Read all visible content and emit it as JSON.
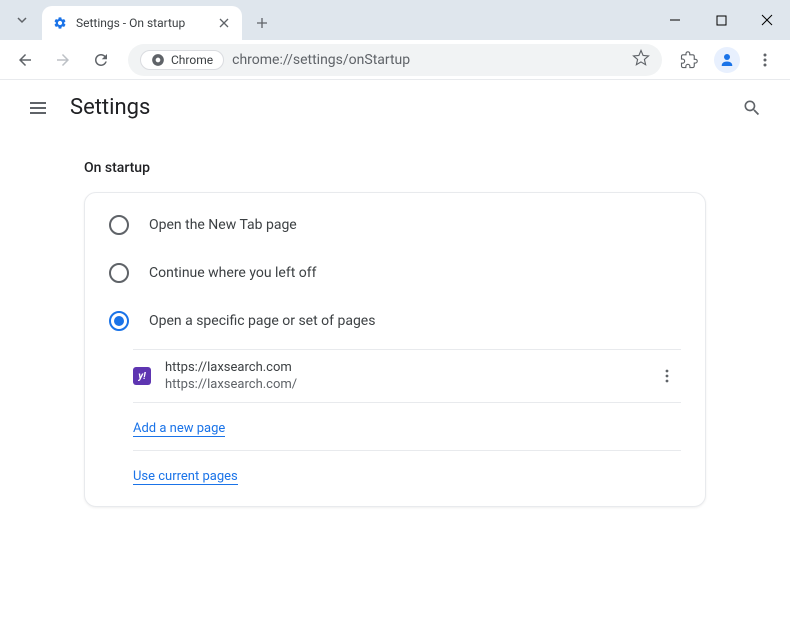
{
  "tab": {
    "title": "Settings - On startup"
  },
  "omnibox": {
    "chip_label": "Chrome",
    "url": "chrome://settings/onStartup"
  },
  "header": {
    "title": "Settings"
  },
  "section": {
    "title": "On startup",
    "radios": {
      "new_tab": "Open the New Tab page",
      "continue": "Continue where you left off",
      "specific": "Open a specific page or set of pages"
    },
    "selected": "specific",
    "pages": [
      {
        "favicon_char": "y!",
        "name": "https://laxsearch.com",
        "url": "https://laxsearch.com/"
      }
    ],
    "add_link": "Add a new page",
    "use_link": "Use current pages"
  }
}
